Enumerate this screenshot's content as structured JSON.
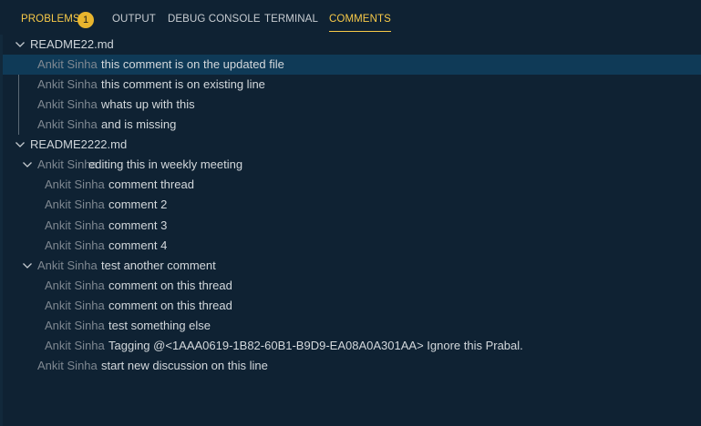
{
  "tabs": [
    {
      "label": "PROBLEMS",
      "badge": "1",
      "active": true
    },
    {
      "label": "OUTPUT",
      "active": false
    },
    {
      "label": "DEBUG CONSOLE",
      "active": false
    },
    {
      "label": "TERMINAL",
      "active": false
    },
    {
      "label": "COMMENTS",
      "active": true
    }
  ],
  "colors": {
    "background": "#0f2233",
    "accent": "#f7c948",
    "selection": "#0f3a57",
    "author": "#7f8891"
  },
  "files": [
    {
      "name": "README22.md",
      "expanded": true,
      "comments": [
        {
          "author": "Ankit Sinha",
          "text": "this comment is on the updated file",
          "selected": true
        },
        {
          "author": "Ankit Sinha",
          "text": "this comment is on existing line"
        },
        {
          "author": "Ankit Sinha",
          "text": "whats up with this"
        },
        {
          "author": "Ankit Sinha",
          "text": "and is missing"
        }
      ]
    },
    {
      "name": "README2222.md",
      "expanded": true,
      "threads": [
        {
          "author": "Ankit Sinha",
          "text": "editing this in weekly meeting",
          "expanded": true,
          "replies": [
            {
              "author": "Ankit Sinha",
              "text": "comment thread"
            },
            {
              "author": "Ankit Sinha",
              "text": "comment 2"
            },
            {
              "author": "Ankit Sinha",
              "text": "comment 3"
            },
            {
              "author": "Ankit Sinha",
              "text": "comment 4"
            }
          ]
        },
        {
          "author": "Ankit Sinha",
          "text": "test another comment",
          "expanded": true,
          "replies": [
            {
              "author": "Ankit Sinha",
              "text": "comment on this thread"
            },
            {
              "author": "Ankit Sinha",
              "text": "comment on this thread"
            },
            {
              "author": "Ankit Sinha",
              "text": "test something else"
            },
            {
              "author": "Ankit Sinha",
              "text": "Tagging @<1AAA0619-1B82-60B1-B9D9-EA08A0A301AA> Ignore this Prabal."
            }
          ]
        },
        {
          "author": "Ankit Sinha",
          "text": "start new discussion on this line"
        }
      ]
    }
  ]
}
